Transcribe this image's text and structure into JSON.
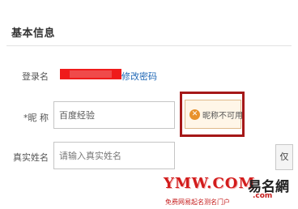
{
  "section": {
    "title": "基本信息"
  },
  "login": {
    "label": "登录名",
    "change_password": "修改密码"
  },
  "nickname": {
    "label": "*昵 称",
    "value": "百度经验",
    "error": "昵称不可用",
    "error_icon": "x-circle-icon"
  },
  "realname": {
    "label": "真实姓名",
    "placeholder": "请输入真实姓名"
  },
  "side_button": {
    "label": "仅"
  },
  "watermark": {
    "logo": "YMW.COM",
    "brand": "易名網",
    "domain": ".com",
    "slogan": "免费网易起名测名门户"
  },
  "colors": {
    "error_border": "#a51818",
    "link": "#1f67b5",
    "redaction": "#ef1b1b",
    "warn_icon": "#e8912b"
  }
}
